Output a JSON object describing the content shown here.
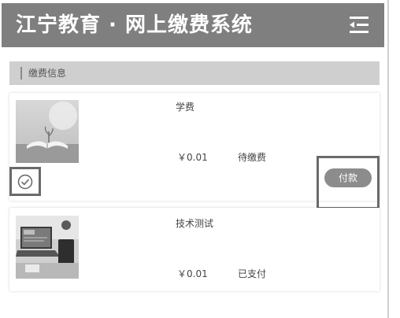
{
  "header": {
    "title": "江宁教育 · 网上缴费系统",
    "menu_icon": "menu-collapse-icon"
  },
  "section": {
    "title": "缴费信息"
  },
  "items": [
    {
      "name": "学费",
      "price": "￥0.01",
      "status": "待缴费",
      "image": "open-book-photo",
      "checkbox_icon": "check-circle-icon",
      "pay_label": "付款"
    },
    {
      "name": "技术测试",
      "price": "￥0.01",
      "status": "已支付",
      "image": "laptop-desk-photo"
    }
  ],
  "colors": {
    "header_bg": "#7f7f7f",
    "section_bg": "#cfcfcf",
    "pay_button_bg": "#8c8c8c",
    "highlight_border": "#6a6a6a"
  }
}
